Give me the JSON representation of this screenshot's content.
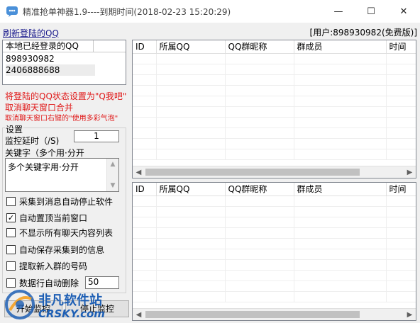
{
  "window": {
    "title": "精准抢单神器1.9----到期时间(2018-02-23 15:20:29)",
    "minimize_glyph": "—",
    "maximize_glyph": "☐",
    "close_glyph": "✕"
  },
  "top": {
    "refresh_link": "刷新登陆的QQ",
    "user_info": "[用户:898930982(免费版)]"
  },
  "local_qq": {
    "header": "本地已经登录的QQ",
    "items": [
      "898930982",
      "2406888688"
    ]
  },
  "notes": {
    "line1": "将登陆的QQ状态设置为\"Q我吧\"",
    "line2": "取消聊天窗口合并",
    "line3": "取消聊天窗口右键的\"使用多彩气泡\""
  },
  "settings": {
    "legend": "设置",
    "delay_label": "监控延时（/S)",
    "delay_value": "1",
    "keyword_label": "关键字（多个用·分开",
    "keyword_value": "多个关键字用·分开",
    "checkboxes": [
      {
        "label": "采集到消息自动停止软件",
        "checked": false,
        "mark": ""
      },
      {
        "label": "自动置顶当前窗口",
        "checked": true,
        "mark": "✓"
      },
      {
        "label": "不显示所有聊天内容列表",
        "checked": false,
        "mark": ""
      },
      {
        "label": "自动保存采集到的信息",
        "checked": false,
        "mark": ""
      },
      {
        "label": "提取新入群的号码",
        "checked": false,
        "mark": ""
      },
      {
        "label": "数据行自动删除",
        "checked": false,
        "mark": ""
      }
    ],
    "auto_delete_value": "50"
  },
  "buttons": {
    "start": "开始监控",
    "stop": "停止监控"
  },
  "table_columns": [
    "ID",
    "所属QQ",
    "QQ群昵称",
    "群成员",
    "时间"
  ],
  "watermark": {
    "line1": "非凡软件站",
    "line2": "CRSKY.com"
  },
  "colors": {
    "note_red": "#e01818",
    "link_blue": "#1a1a8c",
    "watermark_blue": "#1e5fb4",
    "watermark_orange": "#f5a020"
  }
}
